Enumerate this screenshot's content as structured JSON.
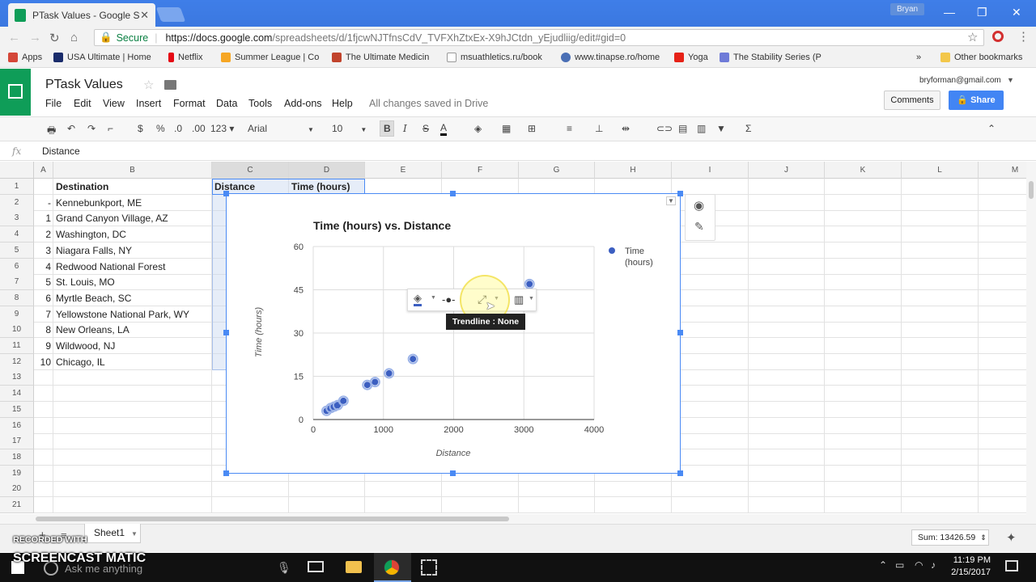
{
  "browser": {
    "tab_title": "PTask Values - Google St",
    "tab_close": "✕",
    "profile_name": "Bryan",
    "secure_label": "Secure",
    "url_host": "https://docs.google.com",
    "url_path": "/spreadsheets/d/1fjcwNJTfnsCdV_TVFXhZtxEx-X9hJCtdn_yEjudliig/edit#gid=0",
    "bookmarks": [
      {
        "label": "Apps",
        "color": "#d44638"
      },
      {
        "label": "USA Ultimate | Home",
        "color": "#1a2c6b"
      },
      {
        "label": "Netflix",
        "color": "#e50914"
      },
      {
        "label": "Summer League | Co",
        "color": "#f6a623"
      },
      {
        "label": "The Ultimate Medicin",
        "color": "#c1432c"
      },
      {
        "label": "msuathletics.ru/book",
        "color": "#999999"
      },
      {
        "label": "www.tinapse.ro/home",
        "color": "#4a6fb5"
      },
      {
        "label": "Yoga",
        "color": "#e62117"
      },
      {
        "label": "The Stability Series (P",
        "color": "#6f7bd8"
      }
    ],
    "bookmarks_more": "»",
    "other_bookmarks": "Other bookmarks"
  },
  "sheets": {
    "doc_title": "PTask Values",
    "menus": [
      "File",
      "Edit",
      "View",
      "Insert",
      "Format",
      "Data",
      "Tools",
      "Add-ons",
      "Help"
    ],
    "saved_status": "All changes saved in Drive",
    "account_email": "bryforman@gmail.com",
    "comments_label": "Comments",
    "share_label": "Share",
    "toolbar": {
      "currency": "$",
      "percent": "%",
      "dec_decrease": ".0",
      "dec_increase": ".00",
      "number_format": "123",
      "font": "Arial",
      "font_size": "10",
      "bold": "B",
      "italic": "I",
      "strike": "S",
      "text_color": "A",
      "sum": "Σ"
    },
    "formula_label": "fx",
    "formula_value": "Distance",
    "columns": [
      "A",
      "B",
      "C",
      "D",
      "E",
      "F",
      "G",
      "H",
      "I",
      "J",
      "K",
      "L",
      "M"
    ],
    "rows": [
      "1",
      "2",
      "3",
      "4",
      "5",
      "6",
      "7",
      "8",
      "9",
      "10",
      "11",
      "12",
      "13",
      "14",
      "15",
      "16",
      "17",
      "18",
      "19",
      "20",
      "21"
    ],
    "header_row": {
      "b": "Destination",
      "c": "Distance",
      "d": "Time (hours)"
    },
    "data_rows": [
      {
        "a": "-",
        "b": "Kennebunkport, ME"
      },
      {
        "a": "1",
        "b": "Grand Canyon Village, AZ"
      },
      {
        "a": "2",
        "b": "Washington, DC"
      },
      {
        "a": "3",
        "b": "Niagara Falls, NY"
      },
      {
        "a": "4",
        "b": "Redwood National Forest"
      },
      {
        "a": "5",
        "b": "St. Louis, MO"
      },
      {
        "a": "6",
        "b": "Myrtle Beach, SC"
      },
      {
        "a": "7",
        "b": "Yellowstone National Park, WY"
      },
      {
        "a": "8",
        "b": "New Orleans, LA"
      },
      {
        "a": "9",
        "b": "Wildwood, NJ"
      },
      {
        "a": "10",
        "b": "Chicago, IL"
      }
    ],
    "sheet_tab": "Sheet1",
    "sum_status": "Sum: 13426.59",
    "tooltip": "Trendline : None"
  },
  "chart_data": {
    "type": "scatter",
    "title": "Time (hours) vs. Distance",
    "xlabel": "Distance",
    "ylabel": "Time (hours)",
    "xlim": [
      0,
      4000
    ],
    "ylim": [
      0,
      60
    ],
    "xticks": [
      "0",
      "1000",
      "2000",
      "3000",
      "4000"
    ],
    "yticks": [
      "0",
      "15",
      "30",
      "45",
      "60"
    ],
    "grid": true,
    "legend_position": "right",
    "series": [
      {
        "name": "Time (hours)",
        "color": "#3c5fc1",
        "x": [
          190,
          250,
          300,
          350,
          430,
          770,
          880,
          1080,
          1420,
          3080
        ],
        "y": [
          3,
          4,
          4.5,
          5,
          6.5,
          12,
          13,
          16,
          21,
          47
        ]
      }
    ]
  },
  "taskbar": {
    "search_placeholder": "Ask me anything",
    "time": "11:19 PM",
    "date": "2/15/2017"
  },
  "watermark": {
    "line1": "RECORDED WITH",
    "line2": "SCREENCAST  MATIC"
  }
}
